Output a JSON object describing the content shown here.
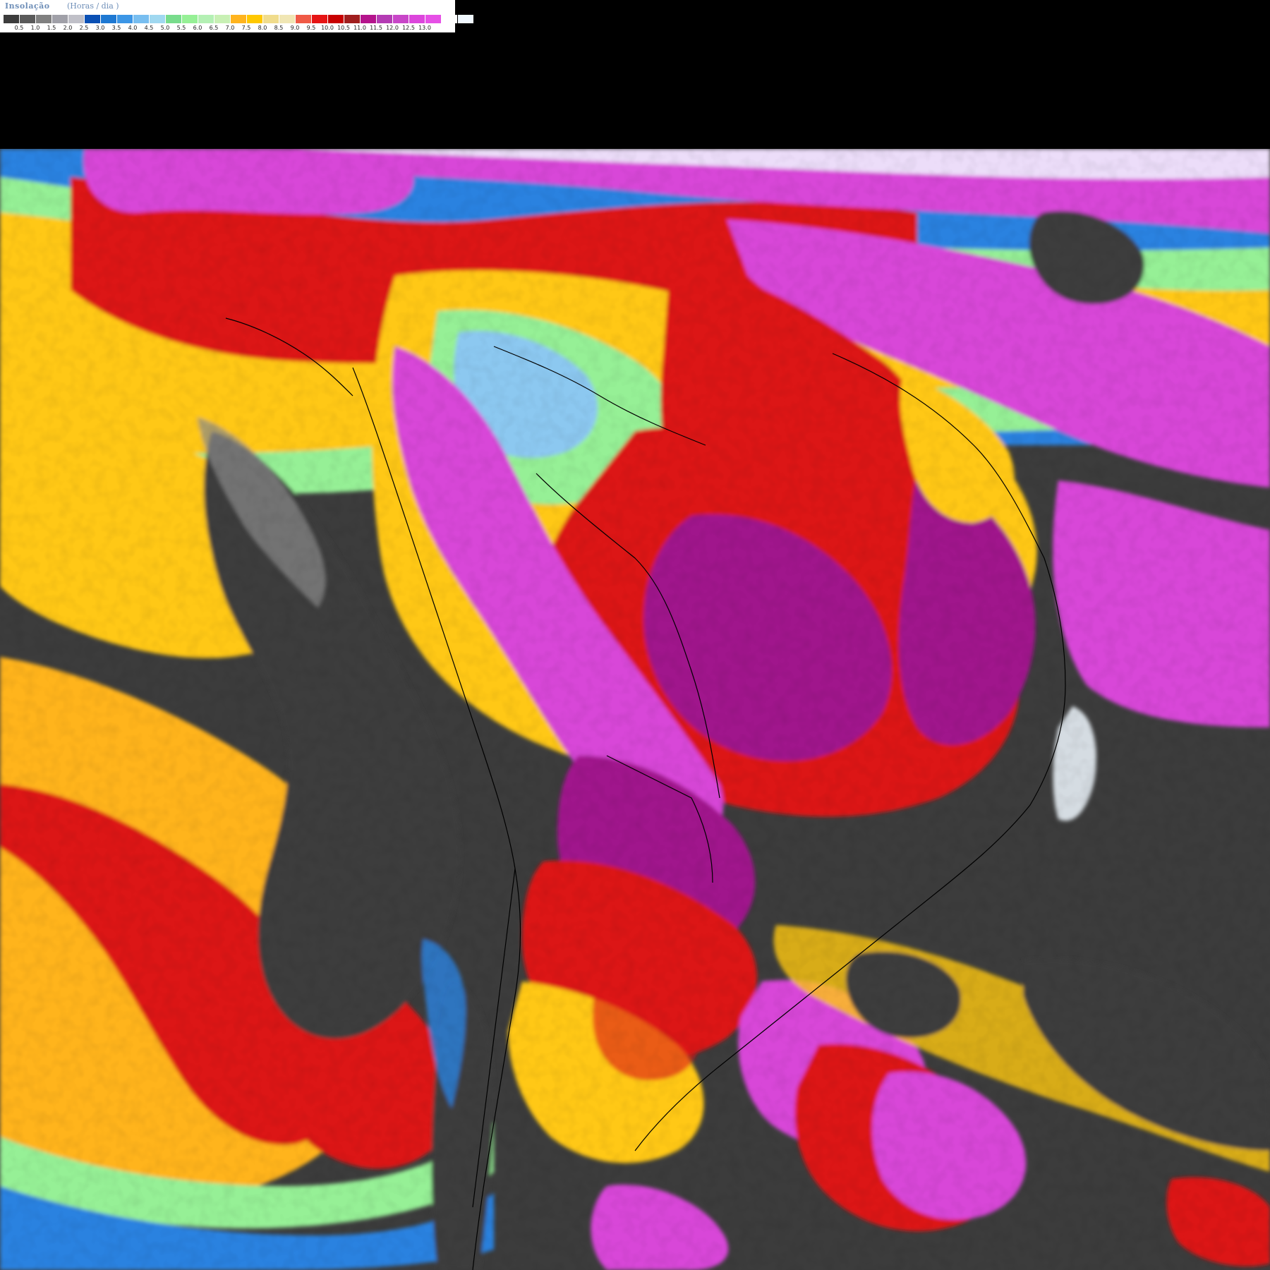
{
  "legend": {
    "title": "Insolação",
    "unit": "(Horas / dia )",
    "colors": [
      "#3c3c3c",
      "#5a5a5a",
      "#808080",
      "#a0a0a8",
      "#c0c0c8",
      "#0a50b4",
      "#1e78d2",
      "#3c96e6",
      "#78bef0",
      "#a0d8f0",
      "#78dc8c",
      "#96f096",
      "#b4f0b4",
      "#c8f0b4",
      "#ffb41e",
      "#ffc800",
      "#f0dc8c",
      "#f0e6b4",
      "#f05a46",
      "#e61414",
      "#c80000",
      "#a01e1e",
      "#b4148c",
      "#b43cb4",
      "#c846c8",
      "#dc46dc",
      "#e650e6",
      "#ffffff",
      "#f0f8ff"
    ],
    "ticks": [
      "0.5",
      "1.0",
      "1.5",
      "2.0",
      "2.5",
      "3.0",
      "3.5",
      "4.0",
      "4.5",
      "5.0",
      "5.5",
      "6.0",
      "6.5",
      "7.0",
      "7.5",
      "8.0",
      "8.5",
      "9.0",
      "9.5",
      "10.0",
      "10.5",
      "11.0",
      "11.5",
      "12.0",
      "12.5",
      "13.0"
    ]
  },
  "map": {
    "palette": {
      "ocean_dark": "#3c3c3c",
      "grey": "#8a8a8a",
      "blue": "#2a82e0",
      "light_blue": "#8cc8f0",
      "green": "#96f096",
      "yellow": "#ffc814",
      "orange": "#ffb41e",
      "red": "#dc1414",
      "dark_red": "#b40a0a",
      "purple": "#a0148c",
      "magenta": "#d846d8",
      "white": "#f0f8ff",
      "border": "#000000"
    }
  }
}
